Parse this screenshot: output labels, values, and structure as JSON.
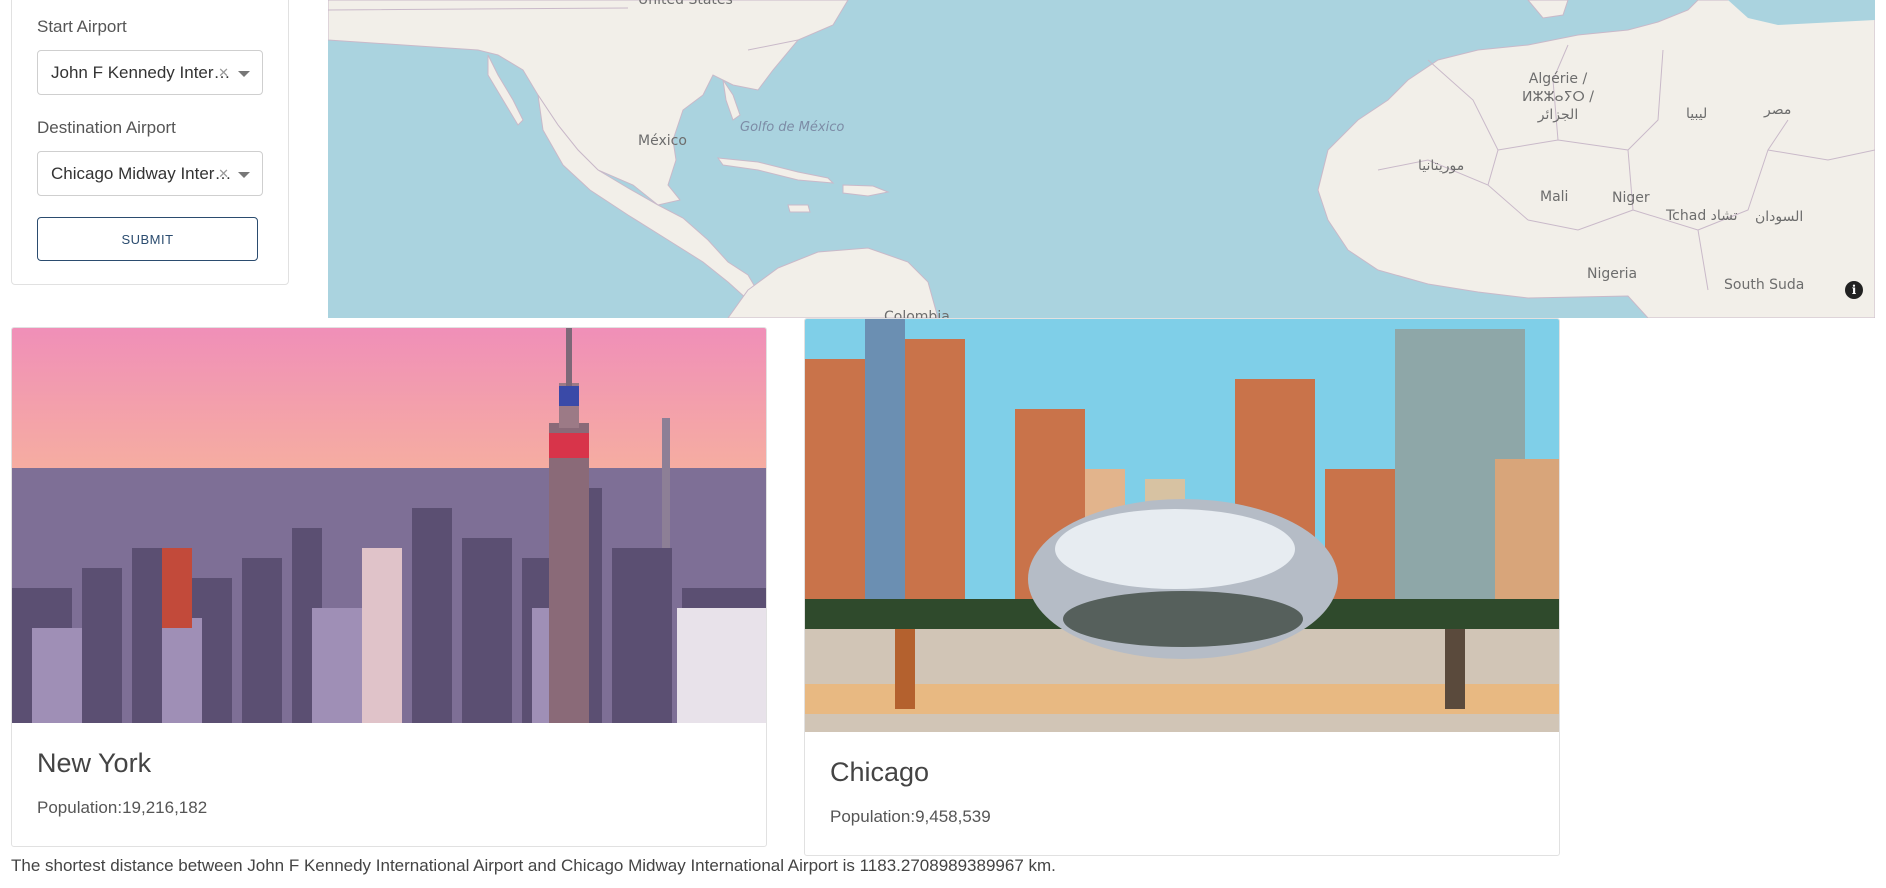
{
  "form": {
    "start_label": "Start Airport",
    "start_value": "John F Kennedy International Airport",
    "destination_label": "Destination Airport",
    "destination_value": "Chicago Midway International Airport",
    "submit_label": "SUBMIT"
  },
  "map": {
    "labels": {
      "united_states": "United States",
      "mexico": "México",
      "gulf": "Golfo de México",
      "algeria": "Algérie / ⵍⵣⵣⴰⵢⵔ / الجزائر",
      "libya": "ليبيا",
      "egypt": "مصر",
      "mauritania": "موريتانيا",
      "mali": "Mali",
      "niger": "Niger",
      "chad": "Tchad تشاد",
      "sudan": "السودان",
      "nigeria": "Nigeria",
      "south_sudan": "South Suda",
      "colombia": "Colombia"
    },
    "info_icon": "info-icon"
  },
  "cities": [
    {
      "name": "New York",
      "population": "Population:19,216,182"
    },
    {
      "name": "Chicago",
      "population": "Population:9,458,539"
    }
  ],
  "result": {
    "text": "The shortest distance between John F Kennedy International Airport and Chicago Midway International Airport is 1183.2708989389967 km."
  }
}
